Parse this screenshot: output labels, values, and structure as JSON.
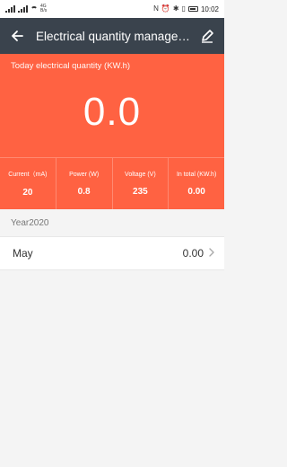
{
  "status_bar": {
    "network_label": "4G",
    "network_speed": "B/s",
    "time": "10:02"
  },
  "header": {
    "title": "Electrical quantity management",
    "back_icon": "arrow-left-icon",
    "edit_icon": "pencil-icon"
  },
  "today": {
    "label": "Today electrical quantity (KW.h)",
    "value": "0.0"
  },
  "stats": [
    {
      "label": "Current（mA)",
      "value": "20"
    },
    {
      "label": "Power (W)",
      "value": "0.8"
    },
    {
      "label": "Voltage (V)",
      "value": "235"
    },
    {
      "label": "In total (KW.h)",
      "value": "0.00"
    }
  ],
  "year_header": "Year2020",
  "months": [
    {
      "label": "May",
      "value": "0.00"
    }
  ],
  "colors": {
    "app_bar": "#3a434d",
    "accent": "#ff6242",
    "background": "#f4f4f4"
  }
}
